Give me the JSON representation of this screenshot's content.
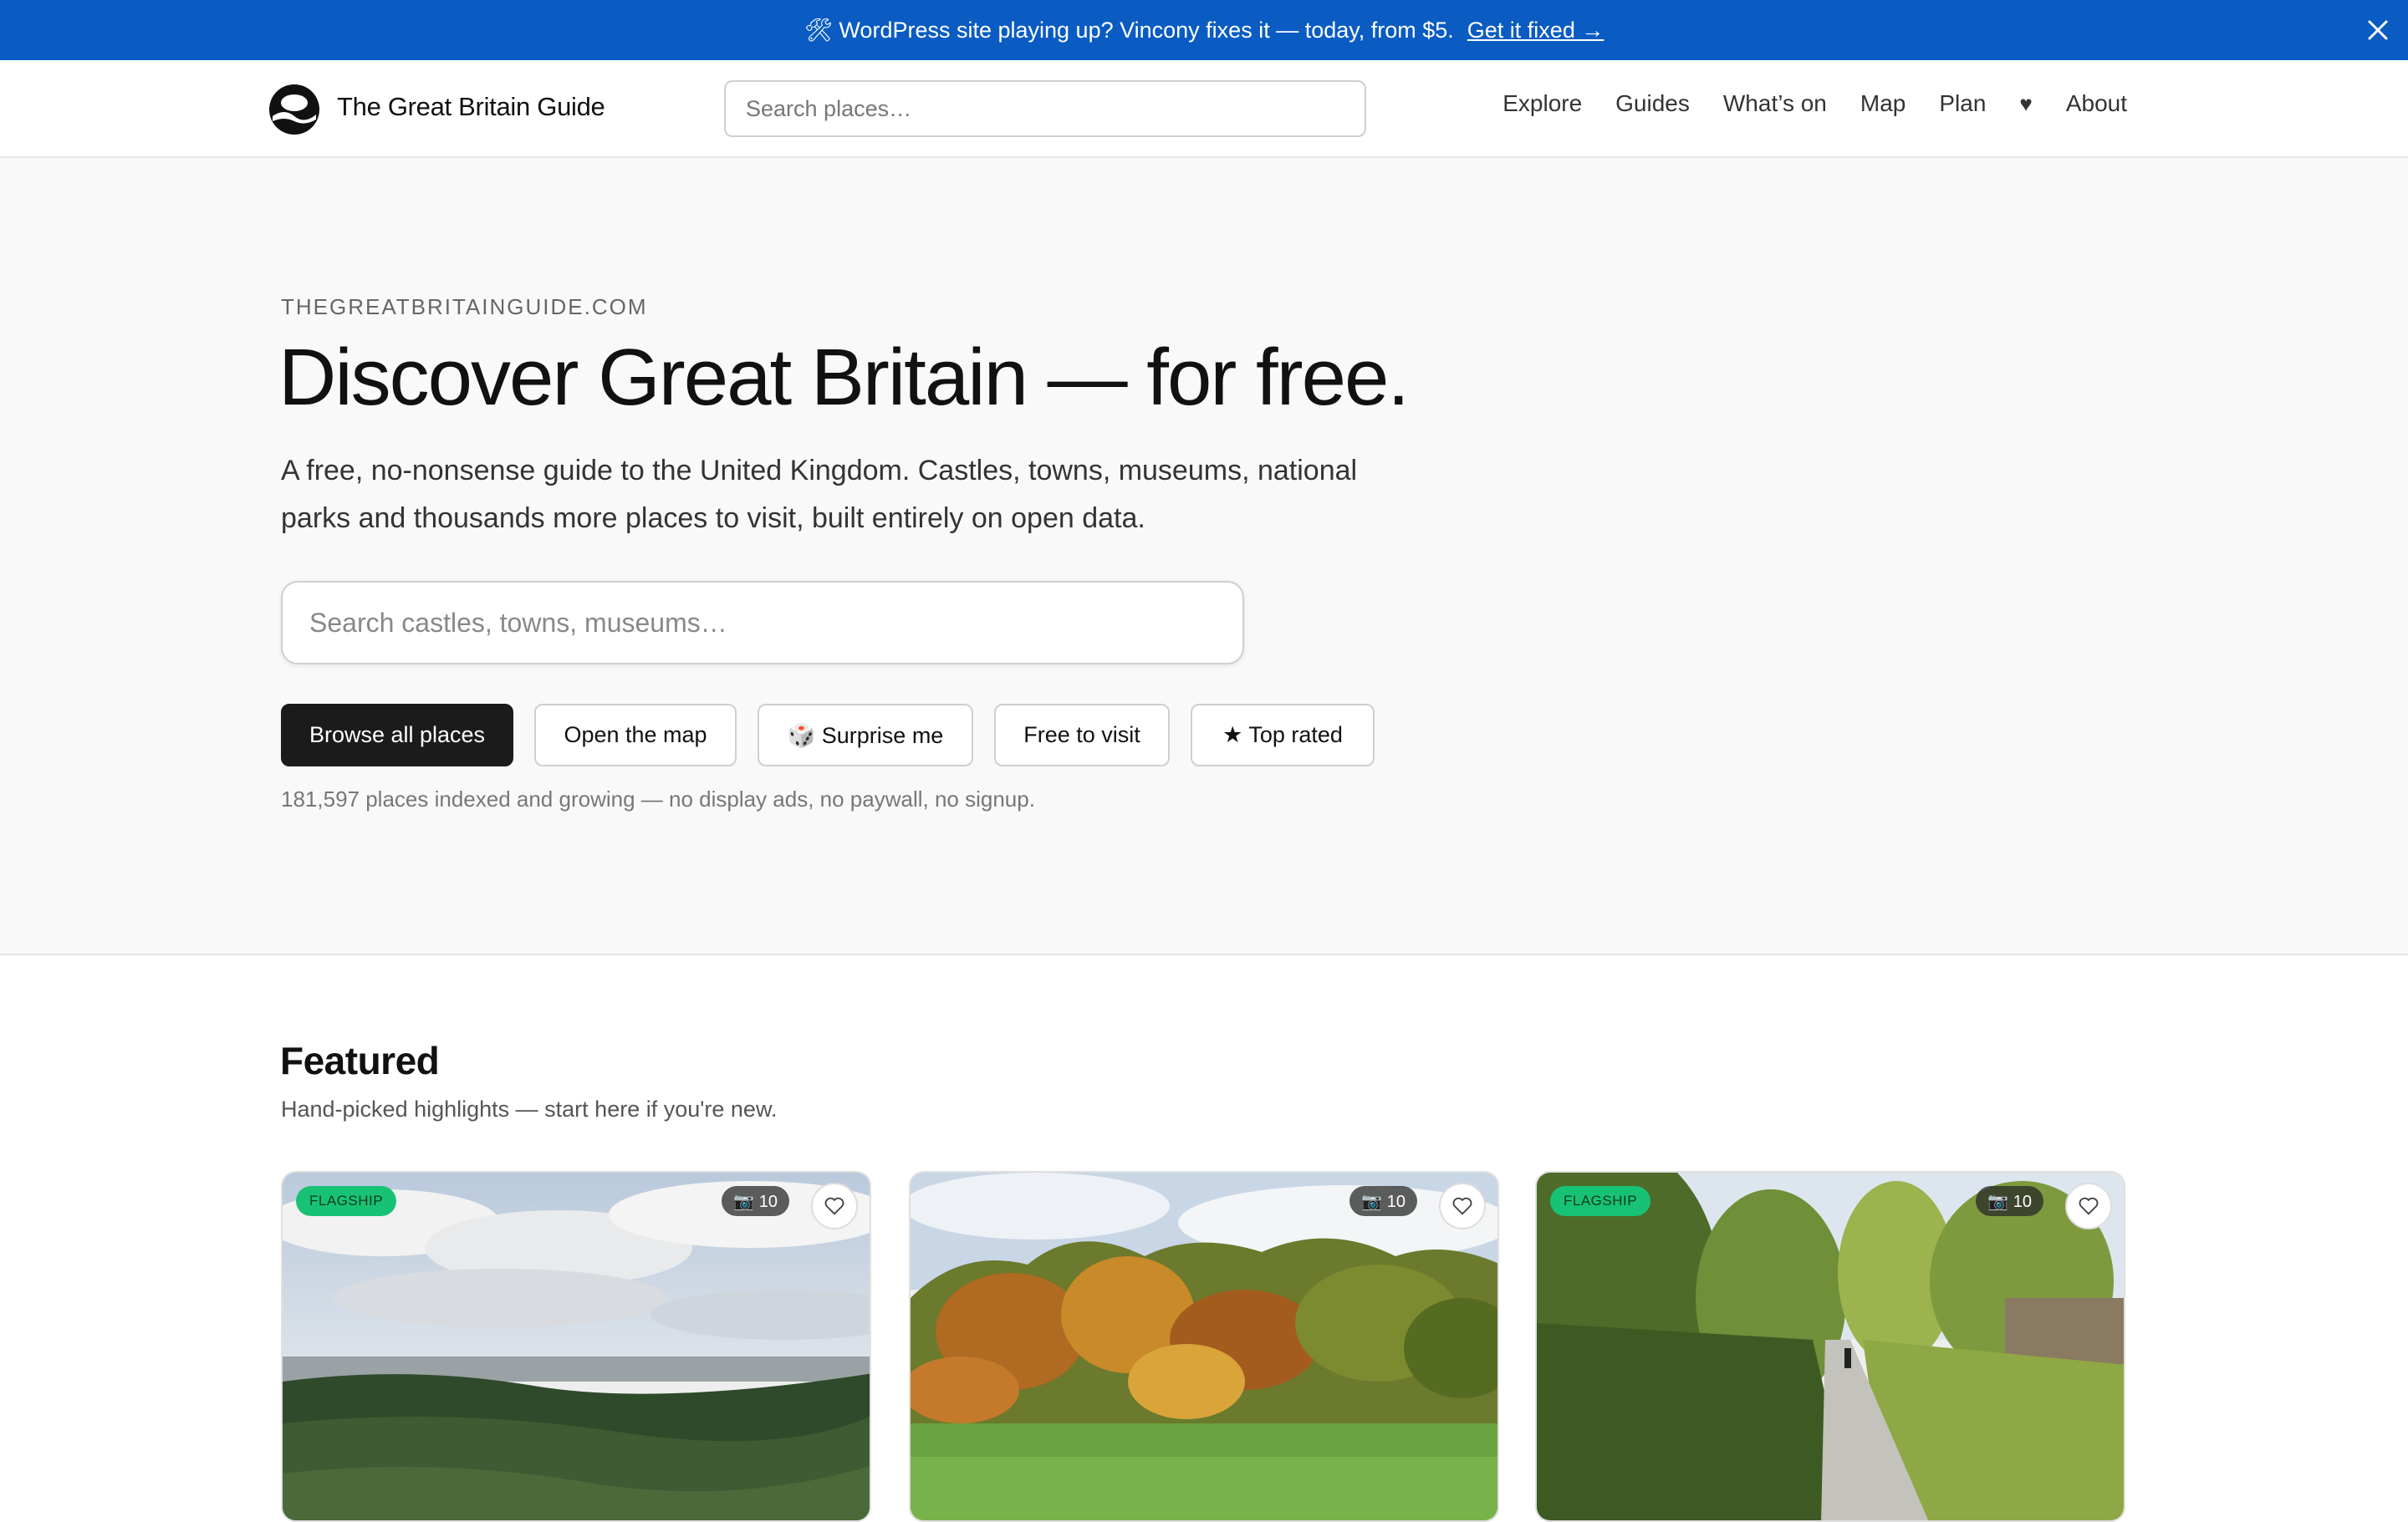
{
  "banner": {
    "message": "🛠 WordPress site playing up? Vincony fixes it — today, from $5.",
    "link": "Get it fixed →",
    "background": "#0a5cc2"
  },
  "header": {
    "brand": "The Great Britain Guide",
    "search_placeholder": "Search places…",
    "nav": [
      "Explore",
      "Guides",
      "What’s on",
      "Map",
      "Plan",
      "♥",
      "About"
    ]
  },
  "hero": {
    "eyebrow": "THEGREATBRITAINGUIDE.COM",
    "title": "Discover Great Britain — for free.",
    "subtitle": "A free, no-nonsense guide to the United Kingdom. Castles, towns, museums, national parks and thousands more places to visit, built entirely on open data.",
    "search_placeholder": "Search castles, towns, museums…",
    "buttons": [
      "Browse all places",
      "Open the map",
      "🎲 Surprise me",
      "Free to visit",
      "★ Top rated"
    ],
    "note": "181,597 places indexed and growing — no display ads, no paywall, no signup."
  },
  "featured": {
    "title": "Featured",
    "subtitle": "Hand-picked highlights — start here if you're new.",
    "cards": [
      {
        "flag": "FLAGSHIP",
        "photos": "📷 10",
        "scene": "hill-view"
      },
      {
        "flag": "",
        "photos": "📷 10",
        "scene": "autumn-park"
      },
      {
        "flag": "FLAGSHIP",
        "photos": "📷 10",
        "scene": "path"
      }
    ],
    "accent_flag": "#18c275"
  }
}
